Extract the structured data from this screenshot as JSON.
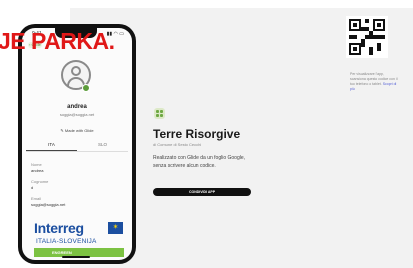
{
  "overlay": {
    "title": "JE PARKA."
  },
  "phone": {
    "status_time": "9:41",
    "status_icons": "▮▮ ◠ ▭",
    "back_label": "‹ Glide",
    "profile": {
      "name": "andrea",
      "email": "soggia@soggia.net",
      "made_with": "✎ Made with Glide"
    },
    "tabs": [
      {
        "label": "ITA"
      },
      {
        "label": "SLO"
      }
    ],
    "fields": [
      {
        "label": "Nome",
        "value": "andrea"
      },
      {
        "label": "Cognome",
        "value": "d"
      },
      {
        "label": "Email",
        "value": "soggia@soggia.net"
      }
    ],
    "logo": {
      "brand": "Interreg",
      "region": "ITALIA-SLOVENIJA",
      "project": "ENGREEN"
    }
  },
  "app": {
    "title": "Terre Risorgive",
    "subtitle": "di Comune di Sesto Cecchi",
    "description": "Realizzato con Glide da un foglio Google, senza scrivere alcun codice.",
    "share_label": "CONDIVIDI APP"
  },
  "qr": {
    "caption": "Per visualizzare l'app, scansiona questo codice con il tuo telefono o tablet.",
    "link_label": "Scopri di più"
  },
  "colors": {
    "title_red": "#e01818",
    "glide_green": "#5c9c3a",
    "interreg_blue": "#1c4fa0",
    "engreen_green": "#7cc242",
    "button_black": "#111111"
  }
}
